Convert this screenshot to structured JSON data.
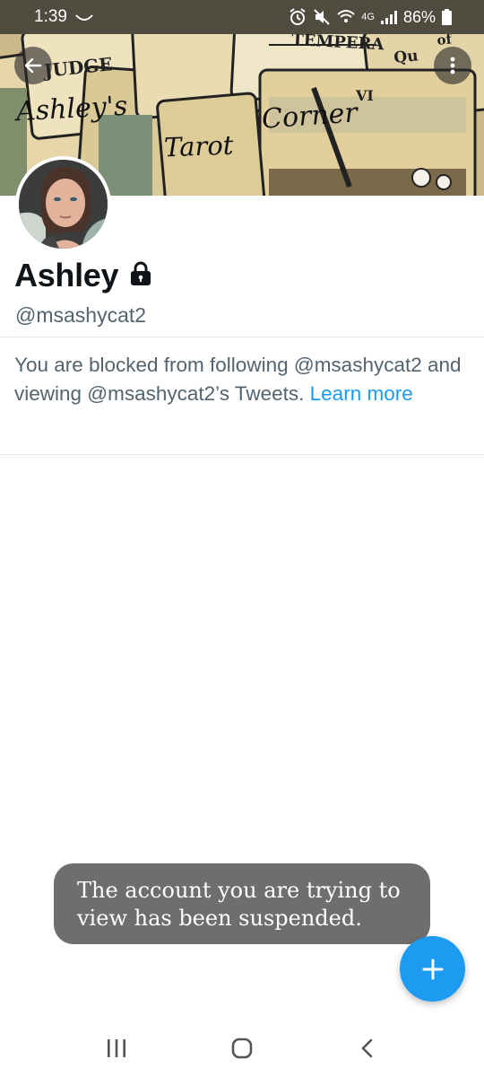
{
  "status_bar": {
    "time": "1:39",
    "network": "4G",
    "battery": "86%"
  },
  "banner": {
    "text_1": "Ashley's",
    "text_2": "Tarot",
    "text_3": "Corner",
    "card_labels": [
      "JUDGE",
      "TEMPERA",
      "Qu",
      "of",
      "VI"
    ]
  },
  "profile": {
    "name": "Ashley",
    "handle": "@msashycat2"
  },
  "blocked_notice": {
    "text": "You are blocked from following @msashycat2 and viewing @msashycat2’s Tweets. ",
    "link": "Learn more"
  },
  "toast": {
    "text": "The account you are trying to view has been suspended."
  },
  "icons": {
    "back": "arrow-left-icon",
    "more": "more-vertical-icon",
    "protected": "lock-icon",
    "compose": "plus-icon"
  },
  "colors": {
    "accent": "#1d9bf0",
    "status_bar": "#4f4b3e",
    "toast": "#6e6e6e"
  }
}
